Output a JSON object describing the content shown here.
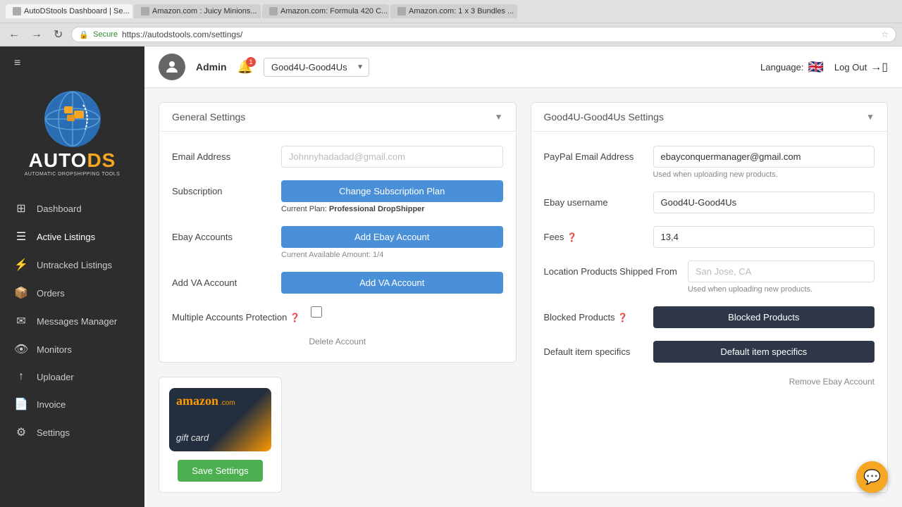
{
  "browser": {
    "tabs": [
      {
        "label": "AutoDStools Dashboard | Se...",
        "active": true
      },
      {
        "label": "Amazon.com : Juicy Minions...",
        "active": false
      },
      {
        "label": "Amazon.com: Formula 420 C...",
        "active": false
      },
      {
        "label": "Amazon.com: 1 x 3 Bundles ...",
        "active": false
      }
    ],
    "url": "https://autods tools.com/settings/",
    "url_display": "https://autodstools.com/settings/"
  },
  "header": {
    "admin_label": "Admin",
    "account_value": "Good4U-Good4Us",
    "language_label": "Language:",
    "logout_label": "Log Out",
    "bell_count": "1"
  },
  "sidebar": {
    "hamburger_icon": "≡",
    "items": [
      {
        "label": "Dashboard",
        "icon": "⊞"
      },
      {
        "label": "Active Listings",
        "icon": "☰"
      },
      {
        "label": "Untracked Listings",
        "icon": "⚡"
      },
      {
        "label": "Orders",
        "icon": "📦"
      },
      {
        "label": "Messages Manager",
        "icon": "✉"
      },
      {
        "label": "Monitors",
        "icon": "👁"
      },
      {
        "label": "Uploader",
        "icon": "↑"
      },
      {
        "label": "Invoice",
        "icon": "📄"
      },
      {
        "label": "Settings",
        "icon": "⚙"
      }
    ]
  },
  "general_settings": {
    "panel_title": "General Settings",
    "email_address_label": "Email Address",
    "email_placeholder": "Johnnyhadadad@gmail.com",
    "subscription_label": "Subscription",
    "subscription_btn": "Change Subscription Plan",
    "current_plan_prefix": "Current Plan:",
    "current_plan": "Professional DropShipper",
    "ebay_accounts_label": "Ebay Accounts",
    "add_ebay_btn": "Add Ebay Account",
    "current_available": "Current Available Amount: 1/4",
    "add_va_label": "Add VA Account",
    "add_va_btn": "Add VA Account",
    "multiple_accounts_label": "Multiple Accounts Protection",
    "delete_account_link": "Delete Account"
  },
  "account_settings": {
    "panel_title": "Good4U-Good4Us Settings",
    "paypal_email_label": "PayPal Email Address",
    "paypal_email_value": "ebayconquermanager@gmail.com",
    "paypal_sub_text": "Used when uploading new products.",
    "ebay_username_label": "Ebay username",
    "ebay_username_value": "Good4U-Good4Us",
    "fees_label": "Fees",
    "fees_value": "13,4",
    "location_label": "Location Products Shipped From",
    "location_placeholder": "San Jose, CA",
    "location_sub_text": "Used when uploading new products.",
    "blocked_products_label": "Blocked Products",
    "blocked_products_btn": "Blocked Products",
    "default_item_label": "Default item specifics",
    "default_item_btn": "Default item specifics",
    "remove_ebay_link": "Remove Ebay Account"
  },
  "save_btn": "Save Settings",
  "amazon_card": {
    "logo": "amazon.com",
    "card_label": "gift card"
  }
}
